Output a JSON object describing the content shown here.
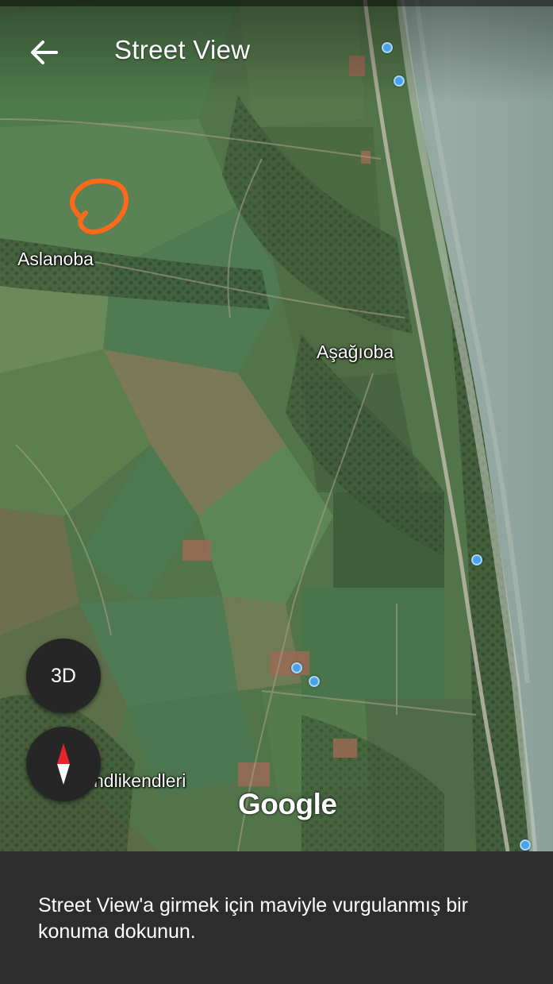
{
  "header": {
    "title": "Street View",
    "back_icon": "arrow-back-icon"
  },
  "map": {
    "type": "satellite",
    "place_labels": [
      "Aslanoba",
      "Aşağıoba",
      "ndlikendleri"
    ],
    "attribution": "Google",
    "street_view_pin_color": "#4aa3e8",
    "annotation_color": "#ff6a1a"
  },
  "controls": {
    "three_d_label": "3D",
    "compass_icon": "compass-icon"
  },
  "instruction": {
    "text": "Street View'a girmek için maviyle vurgulanmış bir konuma dokunun."
  }
}
